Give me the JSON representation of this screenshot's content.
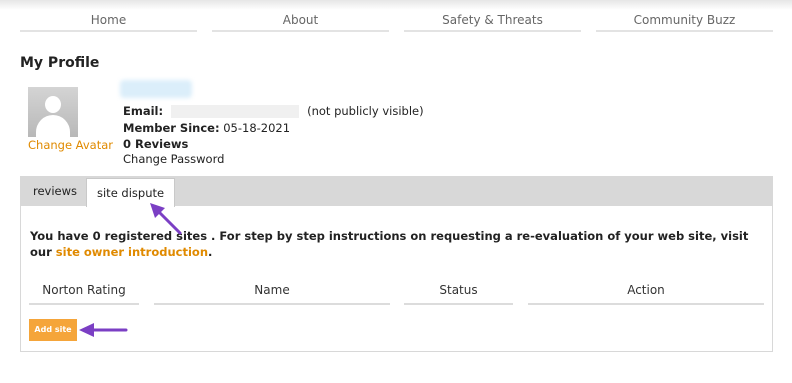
{
  "nav": {
    "items": [
      "Home",
      "About",
      "Safety & Threats",
      "Community Buzz"
    ]
  },
  "page_title": "My Profile",
  "profile": {
    "change_avatar": "Change Avatar",
    "email_label": "Email:",
    "email_note": "(not publicly visible)",
    "member_since_label": "Member Since:",
    "member_since_value": "05-18-2021",
    "reviews_count": "0 Reviews",
    "change_password": "Change Password"
  },
  "tabs": {
    "reviews": "reviews",
    "site_dispute": "site dispute"
  },
  "dispute": {
    "message_prefix": "You have 0 registered sites . For step by step instructions on requesting a re-evaluation of your web site, visit our",
    "message_link": "site owner introduction",
    "message_suffix": ".",
    "columns": [
      "Norton Rating",
      "Name",
      "Status",
      "Action"
    ],
    "add_button": "Add site"
  },
  "colors": {
    "accent_orange": "#e08a00",
    "button_orange": "#f5a53a",
    "annotation_arrow": "#7b3fc4"
  }
}
